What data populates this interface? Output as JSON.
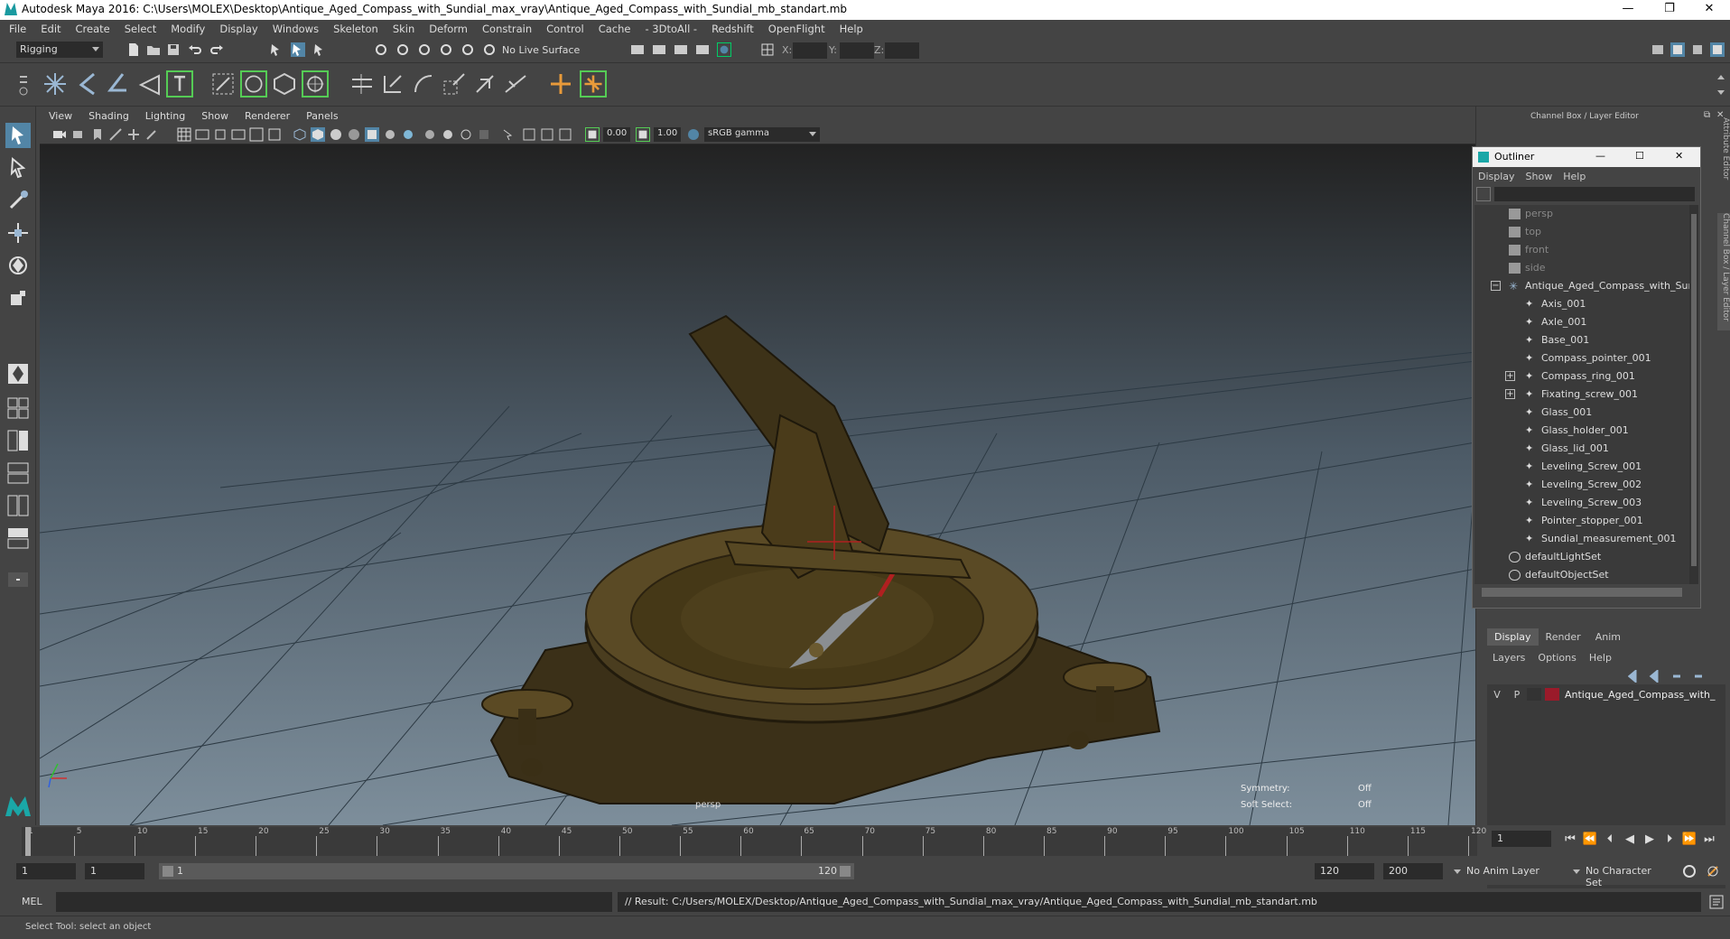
{
  "window": {
    "title": "Autodesk Maya 2016: C:\\Users\\MOLEX\\Desktop\\Antique_Aged_Compass_with_Sundial_max_vray\\Antique_Aged_Compass_with_Sundial_mb_standart.mb"
  },
  "menubar": [
    "File",
    "Edit",
    "Create",
    "Select",
    "Modify",
    "Display",
    "Windows",
    "Skeleton",
    "Skin",
    "Deform",
    "Constrain",
    "Control",
    "Cache",
    "- 3DtoAll -",
    "Redshift",
    "OpenFlight",
    "Help"
  ],
  "status": {
    "menuset": "Rigging",
    "live_surface": "No Live Surface",
    "x_label": "X:",
    "y_label": "Y:",
    "z_label": "Z:"
  },
  "viewport": {
    "menu": [
      "View",
      "Shading",
      "Lighting",
      "Show",
      "Renderer",
      "Panels"
    ],
    "near_value": "0.00",
    "far_value": "1.00",
    "color_space": "sRGB gamma",
    "camera_label": "persp",
    "symmetry_label": "Symmetry:",
    "symmetry_value": "Off",
    "soft_select_label": "Soft Select:",
    "soft_select_value": "Off"
  },
  "channelbox": {
    "title": "Channel Box / Layer Editor"
  },
  "side_tabs": {
    "attribute_editor": "Attribute Editor",
    "channel_box": "Channel Box / Layer Editor"
  },
  "outliner": {
    "title": "Outliner",
    "menu": [
      "Display",
      "Show",
      "Help"
    ],
    "items": [
      {
        "label": "persp",
        "type": "camera",
        "depth": 1,
        "dim": true
      },
      {
        "label": "top",
        "type": "camera",
        "depth": 1,
        "dim": true
      },
      {
        "label": "front",
        "type": "camera",
        "depth": 1,
        "dim": true
      },
      {
        "label": "side",
        "type": "camera",
        "depth": 1,
        "dim": true
      },
      {
        "label": "Antique_Aged_Compass_with_Sun",
        "type": "group",
        "depth": 1,
        "expander": "minus"
      },
      {
        "label": "Axis_001",
        "type": "mesh",
        "depth": 2
      },
      {
        "label": "Axle_001",
        "type": "mesh",
        "depth": 2
      },
      {
        "label": "Base_001",
        "type": "mesh",
        "depth": 2
      },
      {
        "label": "Compass_pointer_001",
        "type": "mesh",
        "depth": 2
      },
      {
        "label": "Compass_ring_001",
        "type": "mesh",
        "depth": 2,
        "expander": "plus"
      },
      {
        "label": "Fixating_screw_001",
        "type": "mesh",
        "depth": 2,
        "expander": "plus"
      },
      {
        "label": "Glass_001",
        "type": "mesh",
        "depth": 2
      },
      {
        "label": "Glass_holder_001",
        "type": "mesh",
        "depth": 2
      },
      {
        "label": "Glass_lid_001",
        "type": "mesh",
        "depth": 2
      },
      {
        "label": "Leveling_Screw_001",
        "type": "mesh",
        "depth": 2
      },
      {
        "label": "Leveling_Screw_002",
        "type": "mesh",
        "depth": 2
      },
      {
        "label": "Leveling_Screw_003",
        "type": "mesh",
        "depth": 2
      },
      {
        "label": "Pointer_stopper_001",
        "type": "mesh",
        "depth": 2
      },
      {
        "label": "Sundial_measurement_001",
        "type": "mesh",
        "depth": 2
      },
      {
        "label": "defaultLightSet",
        "type": "set",
        "depth": 1
      },
      {
        "label": "defaultObjectSet",
        "type": "set",
        "depth": 1
      }
    ]
  },
  "layer_editor": {
    "tabs": [
      "Display",
      "Render",
      "Anim"
    ],
    "menu": [
      "Layers",
      "Options",
      "Help"
    ],
    "layer": {
      "v": "V",
      "p": "P",
      "name": "Antique_Aged_Compass_with_",
      "color": "#9a1a2a"
    }
  },
  "timeline": {
    "ticks": [
      "1",
      "5",
      "10",
      "15",
      "20",
      "25",
      "30",
      "35",
      "40",
      "45",
      "50",
      "55",
      "60",
      "65",
      "70",
      "75",
      "80",
      "85",
      "90",
      "95",
      "100",
      "105",
      "110",
      "115",
      "120"
    ],
    "current_frame": "1"
  },
  "range": {
    "start": "1",
    "playback_start": "1",
    "slider_start": "1",
    "slider_end": "120",
    "playback_end": "120",
    "end": "200",
    "anim_layer": "No Anim Layer",
    "character_set": "No Character Set"
  },
  "cmdline": {
    "mode": "MEL",
    "result": "// Result: C:/Users/MOLEX/Desktop/Antique_Aged_Compass_with_Sundial_max_vray/Antique_Aged_Compass_with_Sundial_mb_standart.mb"
  },
  "helpline": {
    "text": "Select Tool: select an object"
  },
  "colors": {
    "accent": "#5285a6",
    "bg": "#444444",
    "field": "#2b2b2b",
    "layer": "#9a1a2a"
  }
}
